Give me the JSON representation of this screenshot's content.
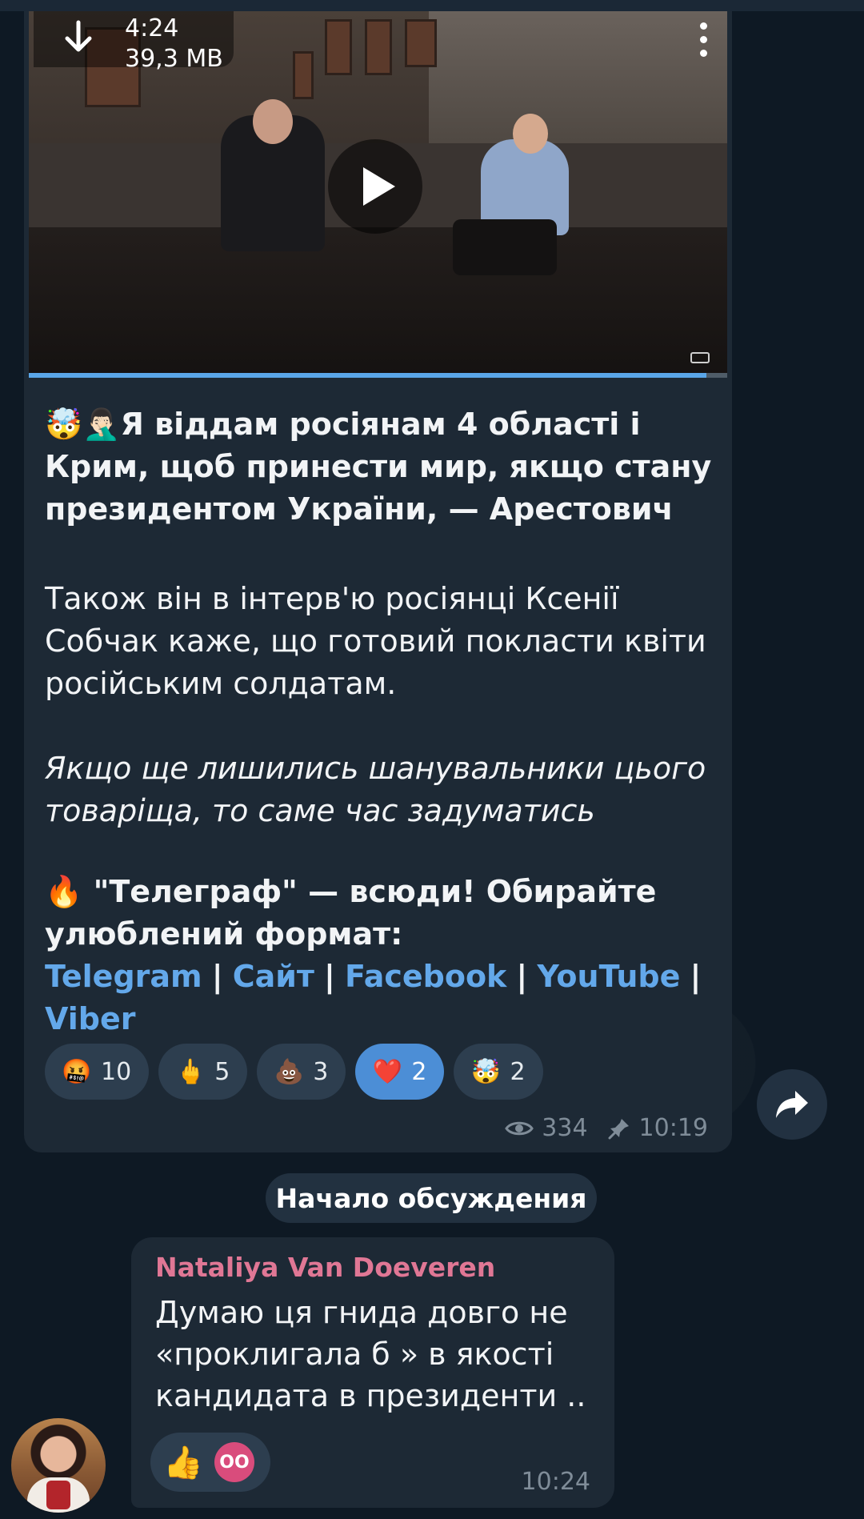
{
  "video": {
    "duration": "4:24",
    "size": "39,3 MB",
    "progress_fraction": 0.97
  },
  "post": {
    "headline_emoji": "🤯🤦🏻‍♂️",
    "headline": "Я віддам росіянам 4 області і Крим, щоб принести мир, якщо стану президентом України, — Арестович",
    "para1": "Також він в інтерв'ю росіянці Ксенії Собчак каже, що готовий покласти квіти російським солдатам.",
    "para2": "Якщо ще лишились шанувальники цього товаріща, то саме час задуматись",
    "promo_emoji": "🔥",
    "promo": "\"Телеграф\" — всюди! Обирайте улюблений формат:",
    "links": [
      "Telegram",
      "Сайт",
      "Facebook",
      "YouTube",
      "Viber"
    ],
    "separator": "|",
    "reactions": [
      {
        "emoji": "🤬",
        "count": "10",
        "active": false
      },
      {
        "emoji": "🖕",
        "count": "5",
        "active": false
      },
      {
        "emoji": "💩",
        "count": "3",
        "active": false
      },
      {
        "emoji": "❤️",
        "count": "2",
        "active": true
      },
      {
        "emoji": "🤯",
        "count": "2",
        "active": false
      }
    ],
    "views": "334",
    "time": "10:19"
  },
  "divider": {
    "label": "Начало обсуждения"
  },
  "comment": {
    "author": "Nataliya Van Doeveren",
    "text": "Думаю ця гнида довго не «проклигала б » в якості кандидата в президенти ..",
    "reaction_emoji": "👍",
    "reactor_initials": "OO",
    "time": "10:24"
  },
  "colors": {
    "bubble": "#1d2935",
    "link": "#63a8ea",
    "author": "#e07795",
    "active_reaction": "#4c8ed6"
  }
}
